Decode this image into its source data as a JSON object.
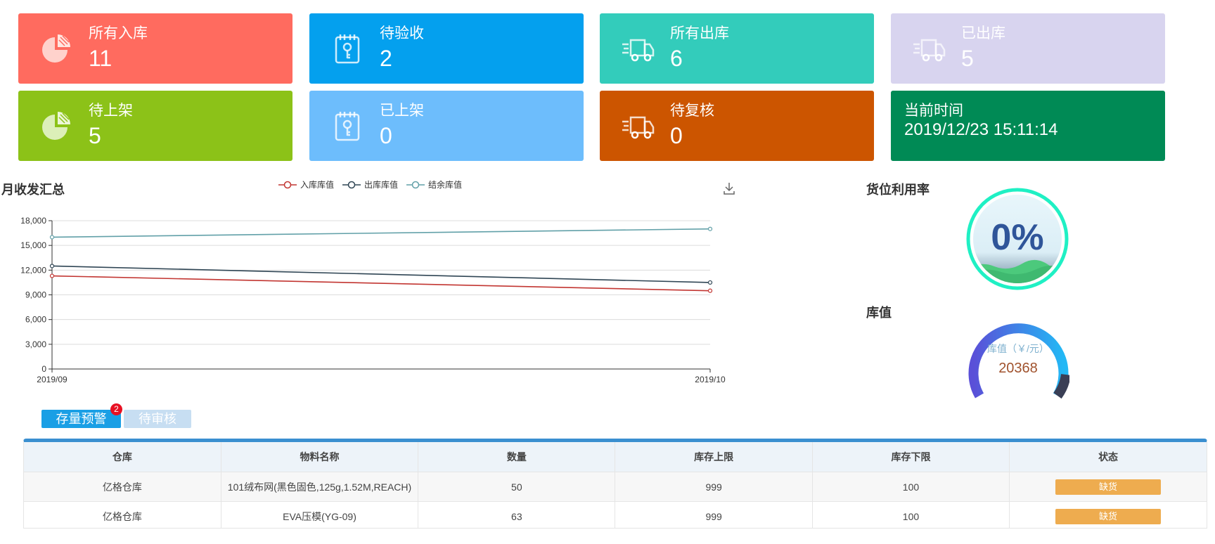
{
  "cards": [
    {
      "title": "所有入库",
      "value": "11",
      "color": "#ff6b5f",
      "icon": "pie-chart-icon"
    },
    {
      "title": "待验收",
      "value": "2",
      "color": "#04a0ee",
      "icon": "clipboard-key-icon"
    },
    {
      "title": "所有出库",
      "value": "6",
      "color": "#33ccbb",
      "icon": "truck-icon"
    },
    {
      "title": "已出库",
      "value": "5",
      "color": "#d8d4ef",
      "icon": "truck-icon"
    },
    {
      "title": "待上架",
      "value": "5",
      "color": "#8cc218",
      "icon": "pie-chart-icon"
    },
    {
      "title": "已上架",
      "value": "0",
      "color": "#6dbdfc",
      "icon": "clipboard-key-icon"
    },
    {
      "title": "待复核",
      "value": "0",
      "color": "#cc5500",
      "icon": "truck-icon"
    },
    {
      "title": "当前时间",
      "value": "2019/12/23 15:11:14",
      "color": "#008a55",
      "icon": ""
    }
  ],
  "sections": {
    "monthly_summary": "月收发汇总",
    "location_utilization": "货位利用率",
    "inventory_value": "库值"
  },
  "chart_data": {
    "type": "line",
    "title": "月收发汇总",
    "x": [
      "2019/09",
      "2019/10"
    ],
    "series": [
      {
        "name": "入库库值",
        "color": "#c23531",
        "values": [
          11300,
          9500
        ]
      },
      {
        "name": "出库库值",
        "color": "#2f4554",
        "values": [
          12500,
          10500
        ]
      },
      {
        "name": "结余库值",
        "color": "#61a0a8",
        "values": [
          16000,
          17000
        ]
      }
    ],
    "yticks": [
      "0",
      "3,000",
      "6,000",
      "9,000",
      "12,000",
      "15,000",
      "18,000"
    ],
    "ylim": [
      0,
      18000
    ],
    "grid": true,
    "legend": "top"
  },
  "gauges": {
    "utilization": {
      "value_text": "0%",
      "value": 0
    },
    "inventory": {
      "label": "库值（￥/元）",
      "value_text": "20368"
    }
  },
  "tabs": {
    "active": "存量预警",
    "inactive": "待审核",
    "badge": "2"
  },
  "table": {
    "headers": [
      "仓库",
      "物料名称",
      "数量",
      "库存上限",
      "库存下限",
      "状态"
    ],
    "rows": [
      [
        "亿格仓库",
        "101绒布网(黑色固色,125g,1.52M,REACH)",
        "50",
        "999",
        "100",
        "缺货"
      ],
      [
        "亿格仓库",
        "EVA压模(YG-09)",
        "63",
        "999",
        "100",
        "缺货"
      ]
    ]
  }
}
